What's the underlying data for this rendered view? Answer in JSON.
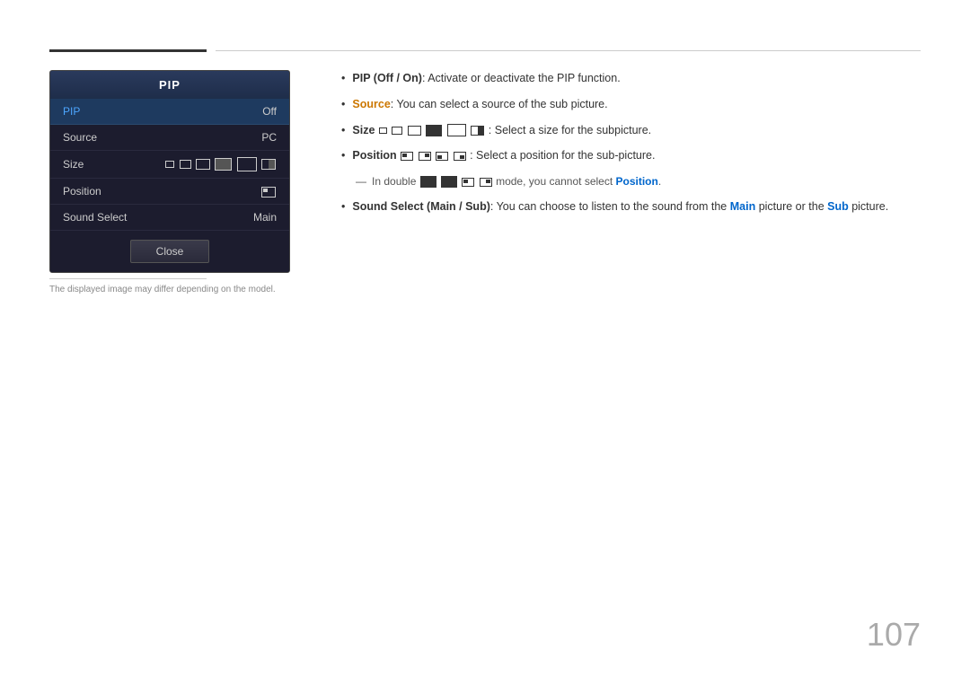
{
  "page": {
    "number": "107",
    "note": "The displayed image may differ depending on the model."
  },
  "pip_panel": {
    "title": "PIP",
    "rows": [
      {
        "label": "PIP",
        "value": "Off",
        "active": true
      },
      {
        "label": "Source",
        "value": "PC",
        "active": false
      },
      {
        "label": "Size",
        "value": "",
        "active": false
      },
      {
        "label": "Position",
        "value": "",
        "active": false
      },
      {
        "label": "Sound Select",
        "value": "Main",
        "active": false
      }
    ],
    "close_button": "Close"
  },
  "content": {
    "bullets": [
      {
        "id": "pip-on-off",
        "prefix_bold": "PIP (Off / On)",
        "prefix_suffix": ": Activate or deactivate the PIP function."
      },
      {
        "id": "source",
        "prefix_bold": "Source",
        "prefix_suffix": ": You can select a source of the sub picture."
      },
      {
        "id": "size",
        "prefix_bold": "Size",
        "prefix_suffix": ": Select a size for the subpicture."
      },
      {
        "id": "position",
        "prefix_bold": "Position",
        "prefix_suffix": ": Select a position for the sub-picture."
      },
      {
        "id": "double-note",
        "text": "In double",
        "suffix_bold": "Position",
        "suffix": " mode, you cannot select",
        "dash": true
      },
      {
        "id": "sound-select",
        "prefix_bold": "Sound Select (Main / Sub)",
        "prefix_suffix": ": You can choose to listen to the sound from the",
        "main_bold": "Main",
        "middle": " picture or the",
        "sub_bold": "Sub",
        "end": " picture."
      }
    ]
  }
}
